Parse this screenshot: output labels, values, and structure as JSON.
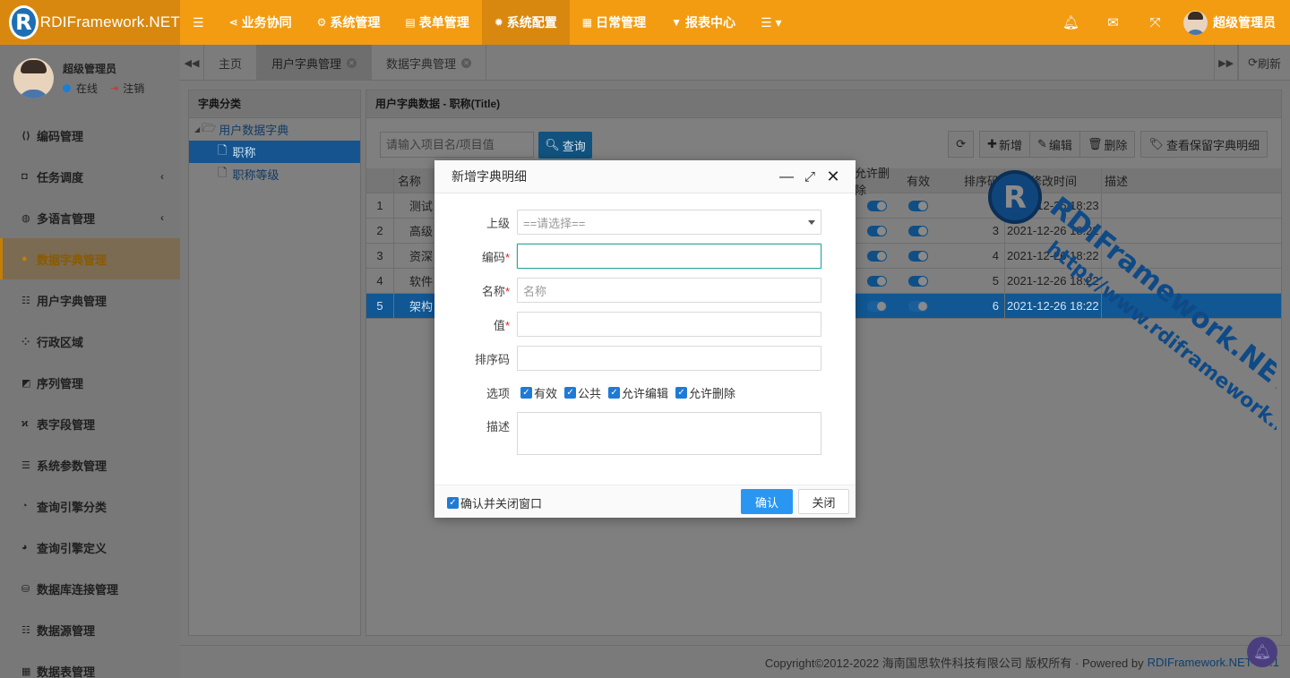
{
  "brand": {
    "logo_letter": "R",
    "title": "RDIFramework.NET"
  },
  "topnav": [
    {
      "icon": "share-icon",
      "label": "业务协同",
      "active": false
    },
    {
      "icon": "cogs-icon",
      "label": "系统管理",
      "active": false
    },
    {
      "icon": "table-icon",
      "label": "表单管理",
      "active": false
    },
    {
      "icon": "gear-icon",
      "label": "系统配置",
      "active": true
    },
    {
      "icon": "calendar-icon",
      "label": "日常管理",
      "active": false
    },
    {
      "icon": "filter-icon",
      "label": "报表中心",
      "active": false
    }
  ],
  "top_user": "超级管理员",
  "sidebar": {
    "user_name": "超级管理员",
    "status": "在线",
    "logout": "注销",
    "items": [
      {
        "icon": "code-icon",
        "label": "编码管理",
        "chevron": false,
        "active": false
      },
      {
        "icon": "square-icon",
        "label": "任务调度",
        "chevron": true,
        "active": false
      },
      {
        "icon": "globe-icon",
        "label": "多语言管理",
        "chevron": true,
        "active": false
      },
      {
        "icon": "bomb-icon",
        "label": "数据字典管理",
        "chevron": false,
        "active": true
      },
      {
        "icon": "list-icon",
        "label": "用户字典管理",
        "chevron": false,
        "active": false
      },
      {
        "icon": "map-icon",
        "label": "行政区域",
        "chevron": false,
        "active": false
      },
      {
        "icon": "sort-icon",
        "label": "序列管理",
        "chevron": false,
        "active": false
      },
      {
        "icon": "field-icon",
        "label": "表字段管理",
        "chevron": false,
        "active": false
      },
      {
        "icon": "params-icon",
        "label": "系统参数管理",
        "chevron": false,
        "active": false
      },
      {
        "icon": "category-icon",
        "label": "查询引擎分类",
        "chevron": false,
        "active": false
      },
      {
        "icon": "engine-icon",
        "label": "查询引擎定义",
        "chevron": false,
        "active": false
      },
      {
        "icon": "database-icon",
        "label": "数据库连接管理",
        "chevron": false,
        "active": false
      },
      {
        "icon": "datasource-icon",
        "label": "数据源管理",
        "chevron": false,
        "active": false
      },
      {
        "icon": "grid-icon",
        "label": "数据表管理",
        "chevron": false,
        "active": false
      }
    ]
  },
  "tabs": {
    "home": "主页",
    "items": [
      {
        "label": "用户字典管理",
        "active": true
      },
      {
        "label": "数据字典管理",
        "active": false
      }
    ],
    "refresh": "刷新"
  },
  "left_panel": {
    "title": "字典分类",
    "root": "用户数据字典",
    "nodes": [
      {
        "label": "职称",
        "selected": true
      },
      {
        "label": "职称等级",
        "selected": false
      }
    ]
  },
  "right_panel": {
    "title": "用户字典数据 - 职称(Title)",
    "search_placeholder": "请输入项目名/项目值",
    "search_btn": "查询",
    "toolbar": {
      "add": "新增",
      "edit": "编辑",
      "delete": "删除",
      "view": "查看保留字典明细"
    },
    "columns": {
      "name": "名称",
      "allow_delete": "允许删除",
      "valid": "有效",
      "sort": "排序码",
      "modified": "最后修改时间",
      "desc": "描述"
    },
    "rows": [
      {
        "idx": "1",
        "name": "测试",
        "sort": "7",
        "time": "2021-12-26 18:23",
        "selected": false
      },
      {
        "idx": "2",
        "name": "高级",
        "sort": "3",
        "time": "2021-12-26 18:22",
        "selected": false
      },
      {
        "idx": "3",
        "name": "资深",
        "sort": "4",
        "time": "2021-12-26 18:22",
        "selected": false
      },
      {
        "idx": "4",
        "name": "软件",
        "sort": "5",
        "time": "2021-12-26 18:22",
        "selected": false
      },
      {
        "idx": "5",
        "name": "架构",
        "sort": "6",
        "time": "2021-12-26 18:22",
        "selected": true
      }
    ]
  },
  "footer": {
    "copyright": "Copyright©2012-2022 海南国思软件科技有限公司 版权所有 · Powered by",
    "brand": "RDIFramework.NET-V5.1"
  },
  "watermark": {
    "brand": "RDIFramework.NET",
    "url": "http://www.rdiframework.net"
  },
  "modal": {
    "title": "新增字典明细",
    "fields": {
      "parent_label": "上级",
      "parent_value": "==请选择==",
      "code_label": "编码",
      "name_label": "名称",
      "name_placeholder": "名称",
      "value_label": "值",
      "sort_label": "排序码",
      "options_label": "选项",
      "desc_label": "描述"
    },
    "options": [
      "有效",
      "公共",
      "允许编辑",
      "允许删除"
    ],
    "confirm_close": "确认并关闭窗口",
    "ok": "确认",
    "close": "关闭"
  },
  "colors": {
    "accent": "#f39c12",
    "primary": "#2997f1",
    "selection": "#105793"
  }
}
